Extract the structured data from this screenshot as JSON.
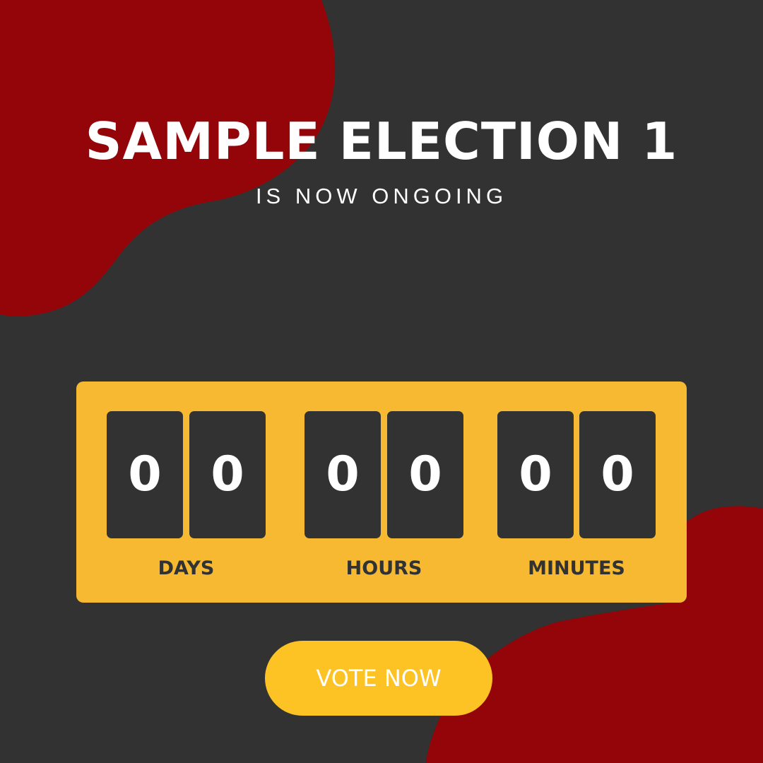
{
  "colors": {
    "background": "#313231",
    "blob": "#940509",
    "panel": "#f7b932",
    "button": "#fdc223",
    "text": "#ffffff"
  },
  "title": "SAMPLE ELECTION 1",
  "subtitle": "IS NOW ONGOING",
  "countdown": {
    "days": {
      "label": "DAYS",
      "digits": [
        "0",
        "0"
      ]
    },
    "hours": {
      "label": "HOURS",
      "digits": [
        "0",
        "0"
      ]
    },
    "minutes": {
      "label": "MINUTES",
      "digits": [
        "0",
        "0"
      ]
    }
  },
  "button": {
    "label": "VOTE NOW"
  }
}
